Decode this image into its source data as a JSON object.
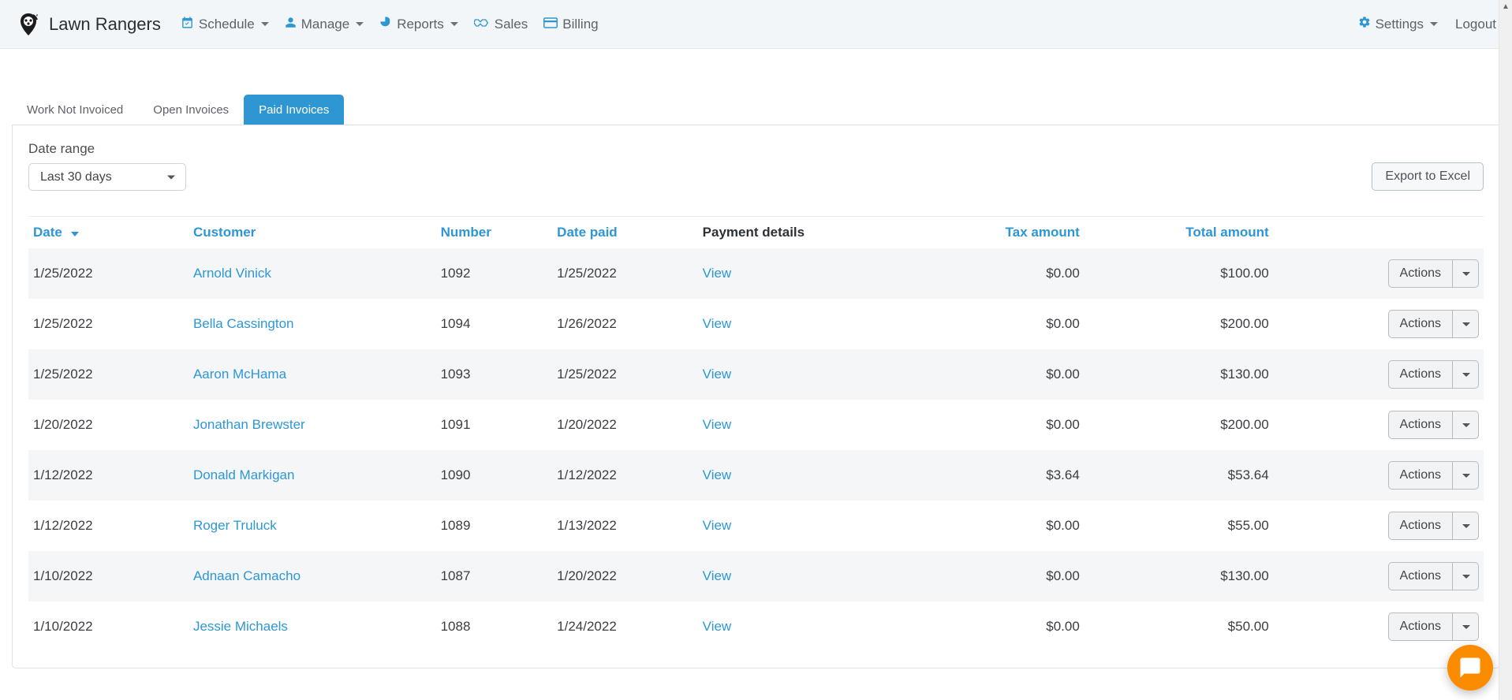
{
  "brand": {
    "name": "Lawn Rangers"
  },
  "nav": {
    "schedule": "Schedule",
    "manage": "Manage",
    "reports": "Reports",
    "sales": "Sales",
    "billing": "Billing",
    "settings": "Settings",
    "logout": "Logout"
  },
  "tabs": {
    "work_not_invoiced": "Work Not Invoiced",
    "open_invoices": "Open Invoices",
    "paid_invoices": "Paid Invoices"
  },
  "filters": {
    "date_range_label": "Date range",
    "date_range_value": "Last 30 days",
    "export_label": "Export to Excel"
  },
  "columns": {
    "date": "Date",
    "customer": "Customer",
    "number": "Number",
    "date_paid": "Date paid",
    "payment_details": "Payment details",
    "tax_amount": "Tax amount",
    "total_amount": "Total amount"
  },
  "view_label": "View",
  "actions_label": "Actions",
  "rows": [
    {
      "date": "1/25/2022",
      "customer": "Arnold Vinick",
      "number": "1092",
      "date_paid": "1/25/2022",
      "tax": "$0.00",
      "total": "$100.00"
    },
    {
      "date": "1/25/2022",
      "customer": "Bella Cassington",
      "number": "1094",
      "date_paid": "1/26/2022",
      "tax": "$0.00",
      "total": "$200.00"
    },
    {
      "date": "1/25/2022",
      "customer": "Aaron McHama",
      "number": "1093",
      "date_paid": "1/25/2022",
      "tax": "$0.00",
      "total": "$130.00"
    },
    {
      "date": "1/20/2022",
      "customer": "Jonathan Brewster",
      "number": "1091",
      "date_paid": "1/20/2022",
      "tax": "$0.00",
      "total": "$200.00"
    },
    {
      "date": "1/12/2022",
      "customer": "Donald Markigan",
      "number": "1090",
      "date_paid": "1/12/2022",
      "tax": "$3.64",
      "total": "$53.64"
    },
    {
      "date": "1/12/2022",
      "customer": "Roger Truluck",
      "number": "1089",
      "date_paid": "1/13/2022",
      "tax": "$0.00",
      "total": "$55.00"
    },
    {
      "date": "1/10/2022",
      "customer": "Adnaan Camacho",
      "number": "1087",
      "date_paid": "1/20/2022",
      "tax": "$0.00",
      "total": "$130.00"
    },
    {
      "date": "1/10/2022",
      "customer": "Jessie Michaels",
      "number": "1088",
      "date_paid": "1/24/2022",
      "tax": "$0.00",
      "total": "$50.00"
    }
  ]
}
